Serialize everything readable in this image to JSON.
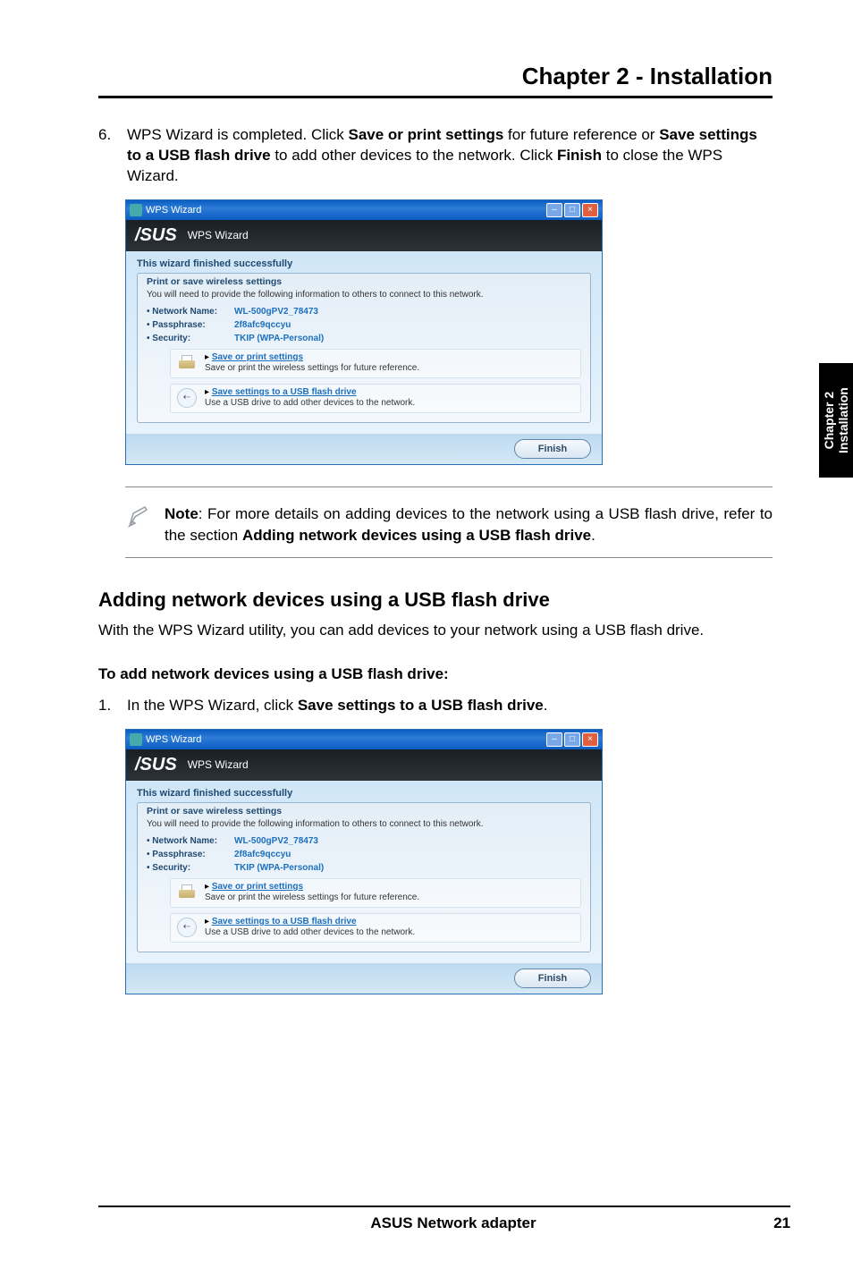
{
  "chapter_header": "Chapter 2 - Installation",
  "step6": {
    "num": "6.",
    "pre": "WPS Wizard is completed. Click ",
    "b1": "Save or print settings",
    "mid1": " for future reference or ",
    "b2": "Save settings to a USB flash drive",
    "mid2": " to add other devices to the network. Click ",
    "b3": "Finish",
    "post": " to close the WPS Wizard."
  },
  "wizard": {
    "titlebar": "WPS Wizard",
    "brand": "/SUS",
    "header_title": "WPS Wizard",
    "finished": "This wizard finished successfully",
    "legend": "Print or save wireless settings",
    "desc": "You will need to provide the following information to others to connect to this network.",
    "kv": {
      "net_k": "• Network Name:",
      "net_v": "WL-500gPV2_78473",
      "pass_k": "• Passphrase:",
      "pass_v": "2f8afc9qccyu",
      "sec_k": "• Security:",
      "sec_v": "TKIP (WPA-Personal)"
    },
    "action1_link": "Save or print settings",
    "action1_sub": "Save or print the wireless settings for future reference.",
    "action2_link": "Save settings to a USB flash drive",
    "action2_sub": "Use a USB drive to add other devices to the network.",
    "finish_btn": "Finish"
  },
  "note": {
    "b1": "Note",
    "t1": ": For more details on adding devices to the network using a USB flash drive, refer to the section ",
    "b2": "Adding network devices using a USB flash drive",
    "t2": "."
  },
  "subheading": "Adding network devices using a USB flash drive",
  "subbody": "With the WPS Wizard utility, you can add devices to your network using a USB flash drive.",
  "steps_heading": "To add network devices using a USB flash drive:",
  "step1": {
    "num": "1.",
    "pre": "In the WPS Wizard, click ",
    "b1": "Save settings to a USB flash drive",
    "post": "."
  },
  "sidetab": {
    "l1": "Chapter 2",
    "l2": "Installation"
  },
  "footer": {
    "title": "ASUS Network adapter",
    "page": "21"
  },
  "icons": {
    "min": "–",
    "max": "□",
    "close": "×",
    "bullet": "▸",
    "usb": "⇠"
  }
}
